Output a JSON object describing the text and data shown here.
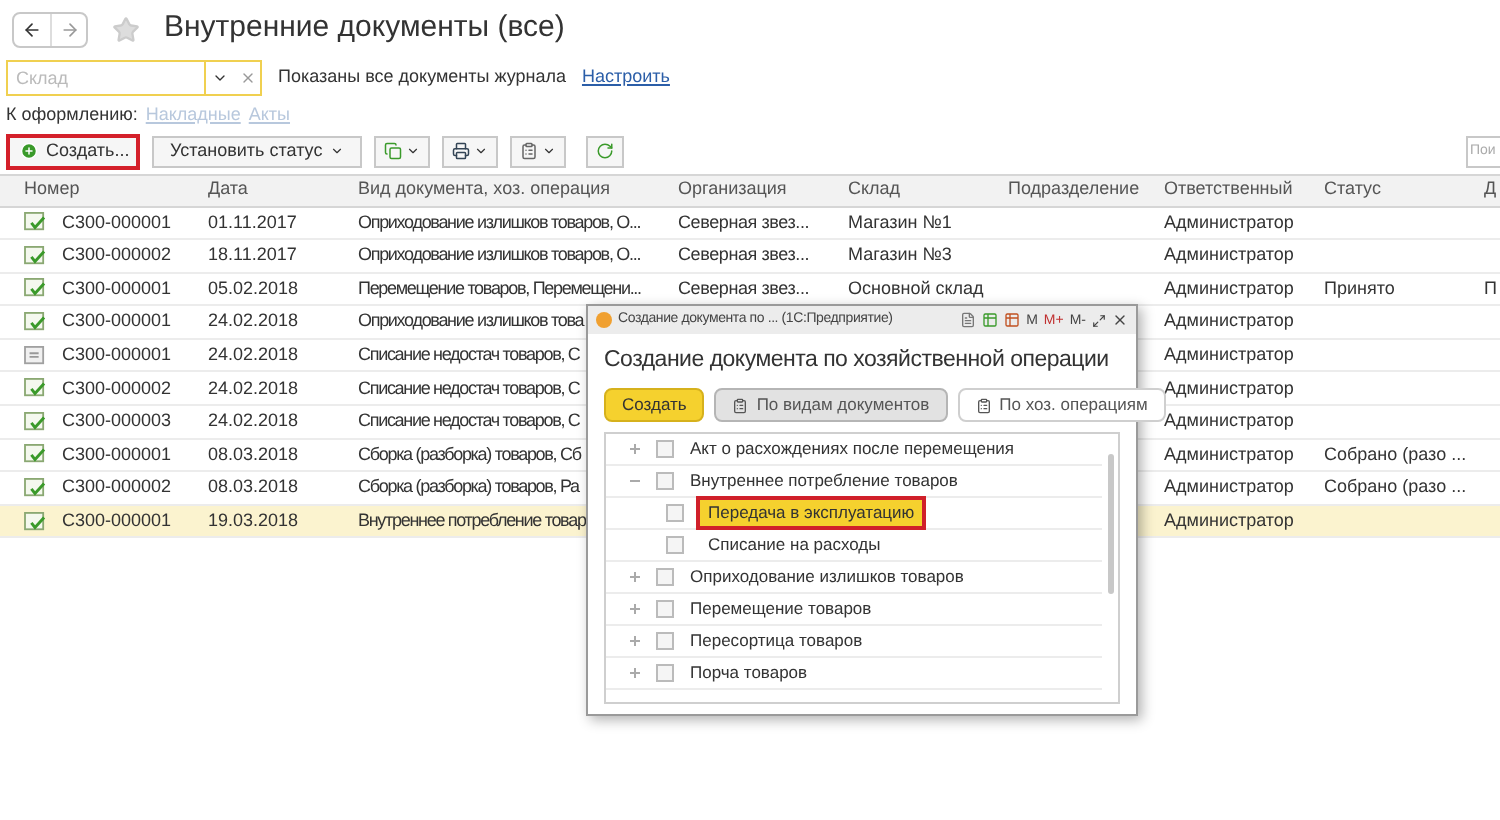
{
  "window": {
    "title": "Внутренние документы (все)"
  },
  "filter": {
    "placeholder": "Склад",
    "info": "Показаны все документы журнала",
    "link": "Настроить"
  },
  "pending": {
    "label": "К оформлению:",
    "links": [
      "Накладные",
      "Акты"
    ]
  },
  "toolbar": {
    "create": "Создать...",
    "status": "Установить статус",
    "search_placeholder": "Пои"
  },
  "table": {
    "columns": [
      "Номер",
      "Дата",
      "Вид документа, хоз. операция",
      "Организация",
      "Склад",
      "Подразделение",
      "Ответственный",
      "Статус",
      "Д"
    ],
    "rows": [
      {
        "posted": true,
        "selected": false,
        "cells": [
          "С300-000001",
          "01.11.2017",
          "Оприходование излишков товаров, О...",
          "Северная звез...",
          "Магазин №1",
          "",
          "Администратор",
          "",
          ""
        ]
      },
      {
        "posted": true,
        "selected": false,
        "cells": [
          "С300-000002",
          "18.11.2017",
          "Оприходование излишков товаров, О...",
          "Северная звез...",
          "Магазин №3",
          "",
          "Администратор",
          "",
          ""
        ]
      },
      {
        "posted": true,
        "selected": false,
        "cells": [
          "С300-000001",
          "05.02.2018",
          "Перемещение товаров, Перемещени...",
          "Северная звез...",
          "Основной склад",
          "",
          "Администратор",
          "Принято",
          "П"
        ]
      },
      {
        "posted": true,
        "selected": false,
        "cells": [
          "С300-000001",
          "24.02.2018",
          "Оприходование излишков това",
          "",
          "",
          "",
          "Администратор",
          "",
          ""
        ]
      },
      {
        "posted": false,
        "selected": false,
        "cells": [
          "С300-000001",
          "24.02.2018",
          "Списание недостач товаров, С",
          "",
          "",
          "",
          "Администратор",
          "",
          ""
        ]
      },
      {
        "posted": true,
        "selected": false,
        "cells": [
          "С300-000002",
          "24.02.2018",
          "Списание недостач товаров, С",
          "",
          "",
          "",
          "Администратор",
          "",
          ""
        ]
      },
      {
        "posted": true,
        "selected": false,
        "cells": [
          "С300-000003",
          "24.02.2018",
          "Списание недостач товаров, С",
          "",
          "",
          "",
          "Администратор",
          "",
          ""
        ]
      },
      {
        "posted": true,
        "selected": false,
        "cells": [
          "С300-000001",
          "08.03.2018",
          "Сборка (разборка) товаров, Сб",
          "",
          "",
          "",
          "Администратор",
          "Собрано (разо ...",
          ""
        ]
      },
      {
        "posted": true,
        "selected": false,
        "cells": [
          "С300-000002",
          "08.03.2018",
          "Сборка (разборка) товаров, Ра",
          "",
          "",
          "",
          "Администратор",
          "Собрано (разо ...",
          ""
        ]
      },
      {
        "posted": true,
        "selected": true,
        "cells": [
          "С300-000001",
          "19.03.2018",
          "Внутреннее потребление товар",
          "",
          "",
          "",
          "Администратор",
          "",
          ""
        ]
      }
    ]
  },
  "dialog": {
    "title": "Создание документа по ... (1С:Предприятие)",
    "window_buttons": [
      "M",
      "M+",
      "M-"
    ],
    "heading": "Создание документа по хозяйственной операции",
    "create": "Создать",
    "views": [
      {
        "label": "По видам документов",
        "selected": true
      },
      {
        "label": "По хоз. операциям",
        "selected": false
      }
    ],
    "tree": [
      {
        "label": "Акт о расхождениях после перемещения",
        "expanded": false
      },
      {
        "label": "Внутреннее потребление товаров",
        "expanded": true,
        "children": [
          {
            "label": "Передача в эксплуатацию",
            "selected": true
          },
          {
            "label": "Списание на расходы",
            "selected": false
          }
        ]
      },
      {
        "label": "Оприходование излишков товаров",
        "expanded": false
      },
      {
        "label": "Перемещение товаров",
        "expanded": false
      },
      {
        "label": "Пересортица товаров",
        "expanded": false
      },
      {
        "label": "Порча товаров",
        "expanded": false
      }
    ]
  }
}
